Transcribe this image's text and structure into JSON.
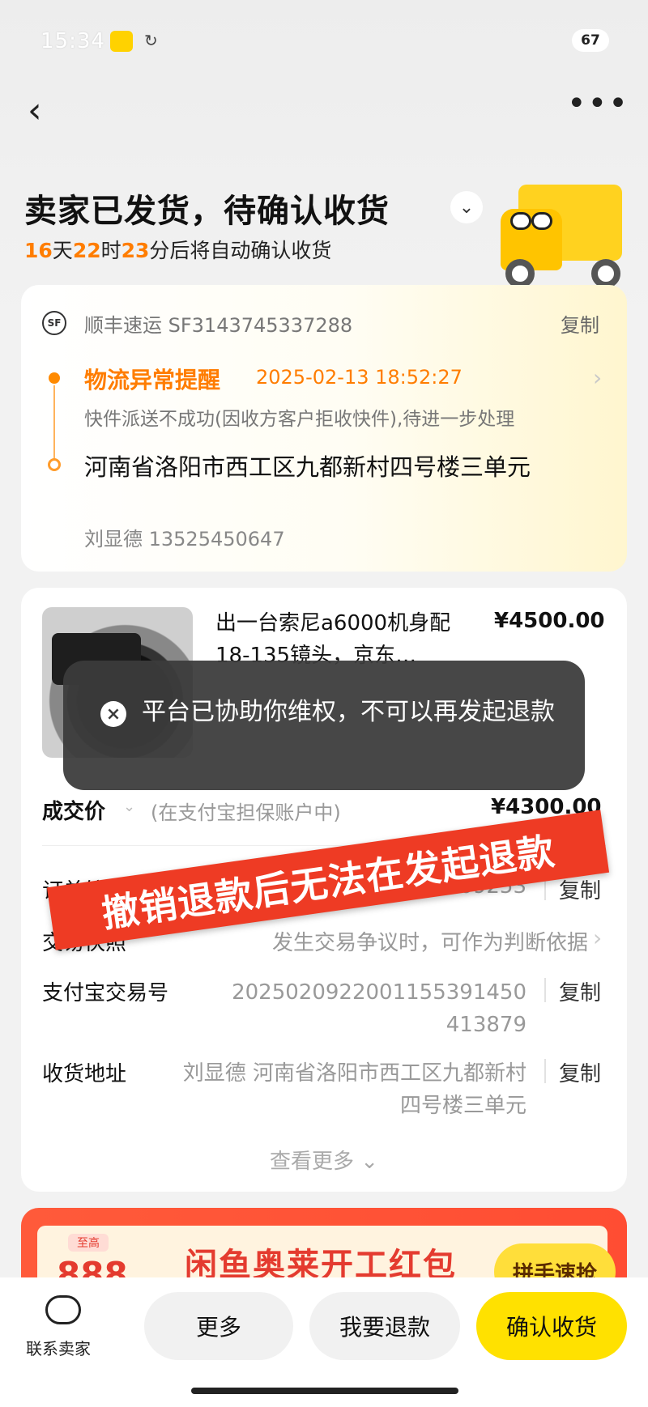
{
  "status_bar": {
    "time": "15:34",
    "battery": "67"
  },
  "header": {
    "back_icon": "‹",
    "more_icon": "•••"
  },
  "order_status": {
    "title": "卖家已发货，待确认收货",
    "countdown": {
      "days": "16",
      "days_unit": "天",
      "hours": "22",
      "hours_unit": "时",
      "minutes": "23",
      "suffix": "分后将自动确认收货"
    }
  },
  "logistics": {
    "courier_icon": "SF",
    "courier": "顺丰速运 SF3143745337288",
    "copy_label": "复制",
    "alert_title": "物流异常提醒",
    "alert_time": "2025-02-13 18:52:27",
    "alert_desc": "快件派送不成功(因收方客户拒收快件),待进一步处理",
    "address": "河南省洛阳市西工区九都新村四号楼三单元",
    "receiver": "刘显德 13525450647"
  },
  "product": {
    "title": "出一台索尼a6000机身配18-135镜头，京东…",
    "price": "¥4500.00"
  },
  "deal": {
    "label": "成交价",
    "note": "(在支付宝担保账户中)",
    "price": "¥4300.00"
  },
  "order_rows": [
    {
      "label": "订单编号",
      "value": "3521508709253",
      "copy": "复制"
    },
    {
      "label": "交易快照",
      "value": "发生交易争议时，可作为判断依据",
      "copy": ""
    },
    {
      "label": "支付宝交易号",
      "value": "2025020922001155391450413879",
      "copy": "复制"
    },
    {
      "label": "收货地址",
      "value": "刘显德 河南省洛阳市西工区九都新村四号楼三单元",
      "copy": "复制"
    }
  ],
  "see_more": "查看更多",
  "toast": {
    "text": "平台已协助你维权，不可以再发起退款"
  },
  "overlay_banner": "撤销退款后无法在发起退款",
  "promo": {
    "badge": "至高",
    "amount": "888",
    "title": "闲鱼奥莱开工红包",
    "button": "拼手速抢"
  },
  "bottom_bar": {
    "contact_label": "联系卖家",
    "more": "更多",
    "refund": "我要退款",
    "confirm": "确认收货"
  },
  "colors": {
    "accent_orange": "#ff7d00",
    "confirm_yellow": "#ffe100",
    "banner_red": "#ee3b24"
  }
}
